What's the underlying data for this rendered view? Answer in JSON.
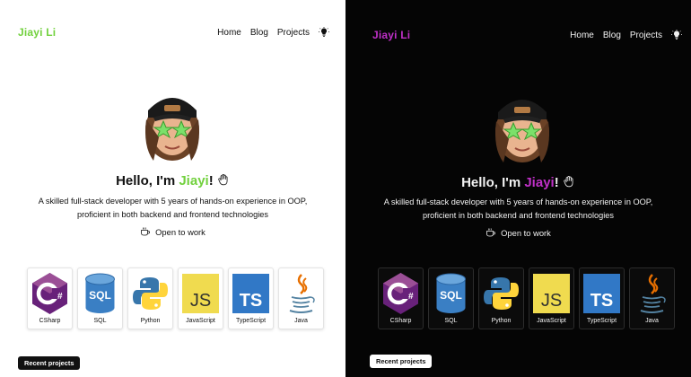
{
  "panes": {
    "light": {
      "brand": "Jiayi Li",
      "nav": [
        "Home",
        "Blog",
        "Projects"
      ],
      "hello_prefix": "Hello, I'm ",
      "hello_name": "Jiayi",
      "hello_suffix": "!",
      "tagline_line1": "A skilled full-stack developer with 5 years of hands-on experience in OOP,",
      "tagline_line2": "proficient in both backend and frontend technologies",
      "status": "Open to work",
      "skills": [
        "CSharp",
        "SQL",
        "Python",
        "JavaScript",
        "TypeScript",
        "Java"
      ],
      "chip": "Recent projects"
    },
    "dark": {
      "brand": "Jiayi Li",
      "nav": [
        "Home",
        "Blog",
        "Projects"
      ],
      "hello_prefix": "Hello, I'm ",
      "hello_name": "Jiayi",
      "hello_suffix": "!",
      "tagline_line1": "A skilled full-stack developer with 5 years of hands-on experience in OOP,",
      "tagline_line2": "proficient in both backend and frontend technologies",
      "status": "Open to work",
      "skills": [
        "CSharp",
        "SQL",
        "Python",
        "JavaScript",
        "TypeScript",
        "Java"
      ],
      "chip": "Recent projects"
    }
  },
  "icons": {
    "theme_toggle": "lightbulb-icon",
    "hello_emoji": "waving-hand-icon",
    "status_icon": "coffee-cup-icon",
    "skill_icons": [
      "csharp-logo-icon",
      "sql-database-icon",
      "python-logo-icon",
      "javascript-logo-icon",
      "typescript-logo-icon",
      "java-logo-icon"
    ]
  },
  "colors": {
    "light_accent": "#72d13e",
    "dark_accent": "#c030c8",
    "light_bg": "#ffffff",
    "dark_bg": "#050505"
  }
}
